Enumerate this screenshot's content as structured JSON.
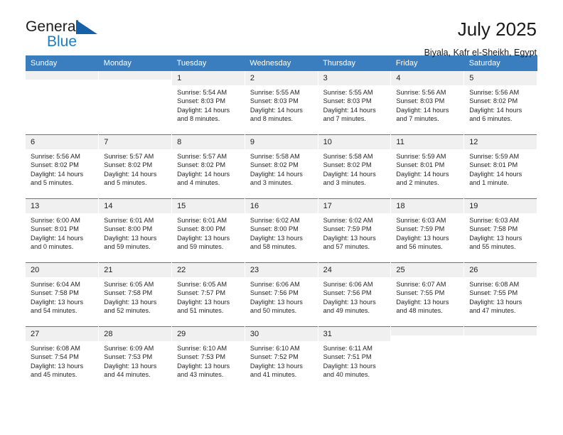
{
  "brand": {
    "name_top": "General",
    "name_bottom": "Blue",
    "triangle_color": "#1461a8",
    "blue_color": "#1d7dc4"
  },
  "header": {
    "title": "July 2025",
    "location": "Biyala, Kafr el-Sheikh, Egypt"
  },
  "theme": {
    "header_blue": "#3b7ebf",
    "daynum_band": "#f0f0f0",
    "text": "#262626"
  },
  "weekday_headers": [
    "Sunday",
    "Monday",
    "Tuesday",
    "Wednesday",
    "Thursday",
    "Friday",
    "Saturday"
  ],
  "weeks": [
    [
      {
        "day": "",
        "sunrise": "",
        "sunset": "",
        "daylight_1": "",
        "daylight_2": ""
      },
      {
        "day": "",
        "sunrise": "",
        "sunset": "",
        "daylight_1": "",
        "daylight_2": ""
      },
      {
        "day": "1",
        "sunrise": "Sunrise: 5:54 AM",
        "sunset": "Sunset: 8:03 PM",
        "daylight_1": "Daylight: 14 hours",
        "daylight_2": "and 8 minutes."
      },
      {
        "day": "2",
        "sunrise": "Sunrise: 5:55 AM",
        "sunset": "Sunset: 8:03 PM",
        "daylight_1": "Daylight: 14 hours",
        "daylight_2": "and 8 minutes."
      },
      {
        "day": "3",
        "sunrise": "Sunrise: 5:55 AM",
        "sunset": "Sunset: 8:03 PM",
        "daylight_1": "Daylight: 14 hours",
        "daylight_2": "and 7 minutes."
      },
      {
        "day": "4",
        "sunrise": "Sunrise: 5:56 AM",
        "sunset": "Sunset: 8:03 PM",
        "daylight_1": "Daylight: 14 hours",
        "daylight_2": "and 7 minutes."
      },
      {
        "day": "5",
        "sunrise": "Sunrise: 5:56 AM",
        "sunset": "Sunset: 8:02 PM",
        "daylight_1": "Daylight: 14 hours",
        "daylight_2": "and 6 minutes."
      }
    ],
    [
      {
        "day": "6",
        "sunrise": "Sunrise: 5:56 AM",
        "sunset": "Sunset: 8:02 PM",
        "daylight_1": "Daylight: 14 hours",
        "daylight_2": "and 5 minutes."
      },
      {
        "day": "7",
        "sunrise": "Sunrise: 5:57 AM",
        "sunset": "Sunset: 8:02 PM",
        "daylight_1": "Daylight: 14 hours",
        "daylight_2": "and 5 minutes."
      },
      {
        "day": "8",
        "sunrise": "Sunrise: 5:57 AM",
        "sunset": "Sunset: 8:02 PM",
        "daylight_1": "Daylight: 14 hours",
        "daylight_2": "and 4 minutes."
      },
      {
        "day": "9",
        "sunrise": "Sunrise: 5:58 AM",
        "sunset": "Sunset: 8:02 PM",
        "daylight_1": "Daylight: 14 hours",
        "daylight_2": "and 3 minutes."
      },
      {
        "day": "10",
        "sunrise": "Sunrise: 5:58 AM",
        "sunset": "Sunset: 8:02 PM",
        "daylight_1": "Daylight: 14 hours",
        "daylight_2": "and 3 minutes."
      },
      {
        "day": "11",
        "sunrise": "Sunrise: 5:59 AM",
        "sunset": "Sunset: 8:01 PM",
        "daylight_1": "Daylight: 14 hours",
        "daylight_2": "and 2 minutes."
      },
      {
        "day": "12",
        "sunrise": "Sunrise: 5:59 AM",
        "sunset": "Sunset: 8:01 PM",
        "daylight_1": "Daylight: 14 hours",
        "daylight_2": "and 1 minute."
      }
    ],
    [
      {
        "day": "13",
        "sunrise": "Sunrise: 6:00 AM",
        "sunset": "Sunset: 8:01 PM",
        "daylight_1": "Daylight: 14 hours",
        "daylight_2": "and 0 minutes."
      },
      {
        "day": "14",
        "sunrise": "Sunrise: 6:01 AM",
        "sunset": "Sunset: 8:00 PM",
        "daylight_1": "Daylight: 13 hours",
        "daylight_2": "and 59 minutes."
      },
      {
        "day": "15",
        "sunrise": "Sunrise: 6:01 AM",
        "sunset": "Sunset: 8:00 PM",
        "daylight_1": "Daylight: 13 hours",
        "daylight_2": "and 59 minutes."
      },
      {
        "day": "16",
        "sunrise": "Sunrise: 6:02 AM",
        "sunset": "Sunset: 8:00 PM",
        "daylight_1": "Daylight: 13 hours",
        "daylight_2": "and 58 minutes."
      },
      {
        "day": "17",
        "sunrise": "Sunrise: 6:02 AM",
        "sunset": "Sunset: 7:59 PM",
        "daylight_1": "Daylight: 13 hours",
        "daylight_2": "and 57 minutes."
      },
      {
        "day": "18",
        "sunrise": "Sunrise: 6:03 AM",
        "sunset": "Sunset: 7:59 PM",
        "daylight_1": "Daylight: 13 hours",
        "daylight_2": "and 56 minutes."
      },
      {
        "day": "19",
        "sunrise": "Sunrise: 6:03 AM",
        "sunset": "Sunset: 7:58 PM",
        "daylight_1": "Daylight: 13 hours",
        "daylight_2": "and 55 minutes."
      }
    ],
    [
      {
        "day": "20",
        "sunrise": "Sunrise: 6:04 AM",
        "sunset": "Sunset: 7:58 PM",
        "daylight_1": "Daylight: 13 hours",
        "daylight_2": "and 54 minutes."
      },
      {
        "day": "21",
        "sunrise": "Sunrise: 6:05 AM",
        "sunset": "Sunset: 7:58 PM",
        "daylight_1": "Daylight: 13 hours",
        "daylight_2": "and 52 minutes."
      },
      {
        "day": "22",
        "sunrise": "Sunrise: 6:05 AM",
        "sunset": "Sunset: 7:57 PM",
        "daylight_1": "Daylight: 13 hours",
        "daylight_2": "and 51 minutes."
      },
      {
        "day": "23",
        "sunrise": "Sunrise: 6:06 AM",
        "sunset": "Sunset: 7:56 PM",
        "daylight_1": "Daylight: 13 hours",
        "daylight_2": "and 50 minutes."
      },
      {
        "day": "24",
        "sunrise": "Sunrise: 6:06 AM",
        "sunset": "Sunset: 7:56 PM",
        "daylight_1": "Daylight: 13 hours",
        "daylight_2": "and 49 minutes."
      },
      {
        "day": "25",
        "sunrise": "Sunrise: 6:07 AM",
        "sunset": "Sunset: 7:55 PM",
        "daylight_1": "Daylight: 13 hours",
        "daylight_2": "and 48 minutes."
      },
      {
        "day": "26",
        "sunrise": "Sunrise: 6:08 AM",
        "sunset": "Sunset: 7:55 PM",
        "daylight_1": "Daylight: 13 hours",
        "daylight_2": "and 47 minutes."
      }
    ],
    [
      {
        "day": "27",
        "sunrise": "Sunrise: 6:08 AM",
        "sunset": "Sunset: 7:54 PM",
        "daylight_1": "Daylight: 13 hours",
        "daylight_2": "and 45 minutes."
      },
      {
        "day": "28",
        "sunrise": "Sunrise: 6:09 AM",
        "sunset": "Sunset: 7:53 PM",
        "daylight_1": "Daylight: 13 hours",
        "daylight_2": "and 44 minutes."
      },
      {
        "day": "29",
        "sunrise": "Sunrise: 6:10 AM",
        "sunset": "Sunset: 7:53 PM",
        "daylight_1": "Daylight: 13 hours",
        "daylight_2": "and 43 minutes."
      },
      {
        "day": "30",
        "sunrise": "Sunrise: 6:10 AM",
        "sunset": "Sunset: 7:52 PM",
        "daylight_1": "Daylight: 13 hours",
        "daylight_2": "and 41 minutes."
      },
      {
        "day": "31",
        "sunrise": "Sunrise: 6:11 AM",
        "sunset": "Sunset: 7:51 PM",
        "daylight_1": "Daylight: 13 hours",
        "daylight_2": "and 40 minutes."
      },
      {
        "day": "",
        "sunrise": "",
        "sunset": "",
        "daylight_1": "",
        "daylight_2": ""
      },
      {
        "day": "",
        "sunrise": "",
        "sunset": "",
        "daylight_1": "",
        "daylight_2": ""
      }
    ]
  ]
}
